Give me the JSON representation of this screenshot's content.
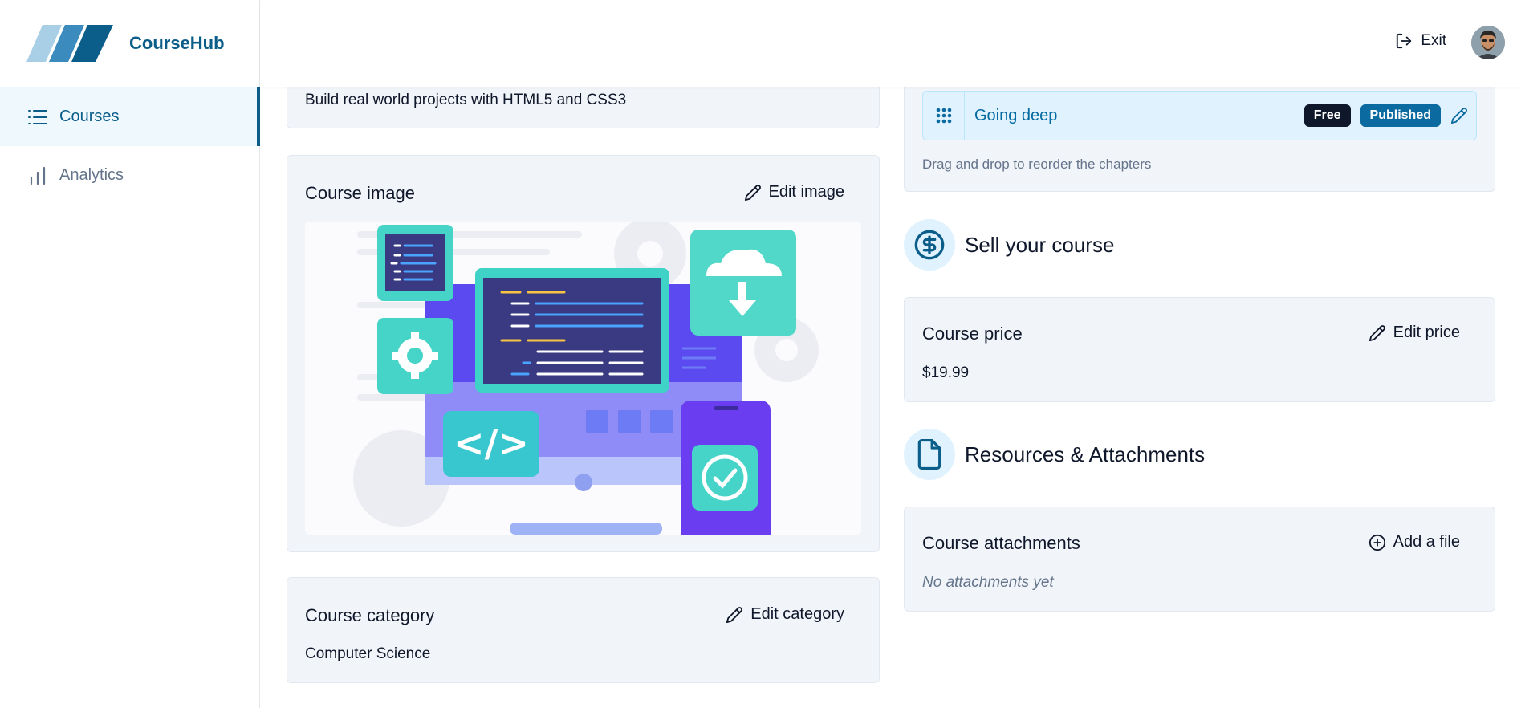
{
  "app": {
    "name": "CourseHub"
  },
  "sidebar": {
    "items": [
      {
        "label": "Courses",
        "icon": "list-icon",
        "active": true
      },
      {
        "label": "Analytics",
        "icon": "bar-chart-icon",
        "active": false
      }
    ]
  },
  "header": {
    "exit_label": "Exit"
  },
  "description_card": {
    "value": "Build real world projects with HTML5 and CSS3"
  },
  "image_card": {
    "title": "Course image",
    "action_label": "Edit image"
  },
  "category_card": {
    "title": "Course category",
    "action_label": "Edit category",
    "value": "Computer Science"
  },
  "chapters_card": {
    "chapter": {
      "title": "Going deep",
      "badge_free": "Free",
      "badge_published": "Published"
    },
    "hint": "Drag and drop to reorder the chapters"
  },
  "sell_section": {
    "title": "Sell your course",
    "icon": "dollar-circle-icon"
  },
  "price_card": {
    "title": "Course price",
    "action_label": "Edit price",
    "value": "$19.99"
  },
  "resources_section": {
    "title": "Resources & Attachments",
    "icon": "file-icon"
  },
  "attachments_card": {
    "title": "Course attachments",
    "action_label": "Add a file",
    "empty_text": "No attachments yet"
  },
  "colors": {
    "brand": "#0b5d8a",
    "card_bg": "#f1f5f9",
    "badge_dark": "#0f172a",
    "badge_published": "#0b6aa0"
  }
}
